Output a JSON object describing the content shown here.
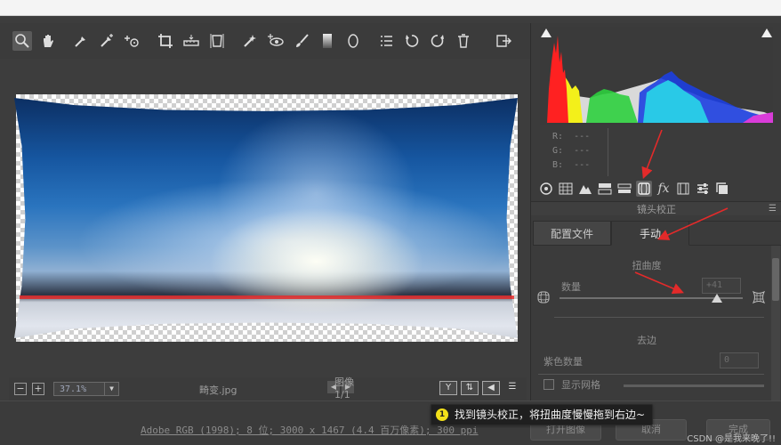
{
  "toolbar": {
    "tools": [
      "zoom-tool-icon",
      "hand-tool-icon",
      "white-balance-icon",
      "color-sampler-icon",
      "targeted-adjust-icon",
      "crop-icon",
      "straighten-icon",
      "transform-icon",
      "spot-removal-icon",
      "red-eye-icon",
      "adjustment-brush-icon",
      "graduated-filter-icon",
      "radial-filter-icon",
      "preferences-icon",
      "rotate-ccw-icon",
      "rotate-cw-icon",
      "trash-icon"
    ],
    "open_icon": "open-image-icon"
  },
  "canvas": {
    "zoom": "37.1%",
    "filename": "畸变.jpg",
    "image_counter": "图像 1/1"
  },
  "histogram": {
    "r_label": "R:",
    "r_value": "---",
    "g_label": "G:",
    "g_value": "---",
    "b_label": "B:",
    "b_value": "---"
  },
  "panel": {
    "section_title": "镜头校正",
    "tabs": {
      "profile": "配置文件",
      "manual": "手动"
    },
    "distortion": {
      "title": "扭曲度",
      "amount_label": "数量",
      "amount_value": "+41",
      "amount_level": 0.86
    },
    "defringe": {
      "title": "去边",
      "purple_label": "紫色数量",
      "purple_value": "0"
    },
    "show_grid_label": "显示网格"
  },
  "footer": {
    "info": "Adobe RGB (1998); 8 位; 3000 x 1467 (4.4 百万像素); 300 ppi",
    "open_button": "打开图像",
    "cancel_button": "取消",
    "done_button": "完成"
  },
  "tooltip": {
    "number": "1",
    "text": "找到镜头校正，将扭曲度慢慢拖到右边~"
  },
  "watermark": "CSDN @是我来晚了!!",
  "colors": {
    "accent_red": "#e32a2a",
    "tooltip_badge": "#f3e01a"
  }
}
